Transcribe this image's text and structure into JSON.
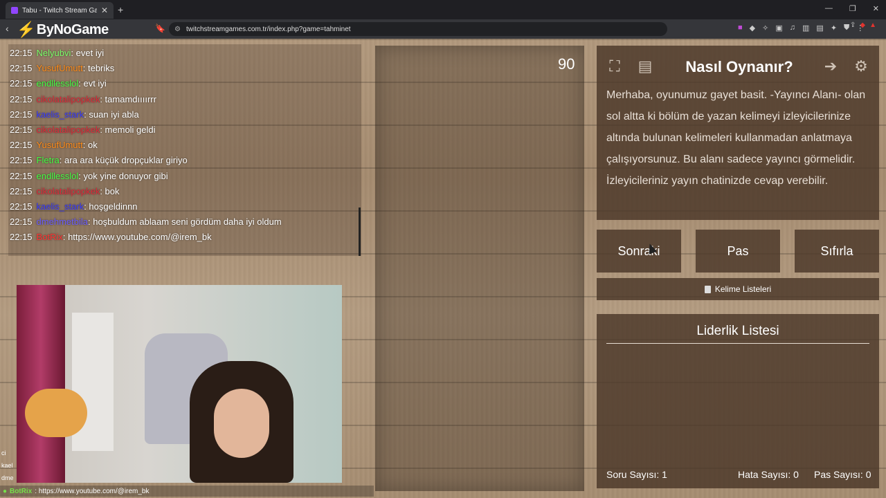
{
  "browser": {
    "tab_title": "Tabu - Twitch Stream Games",
    "new_tab": "+",
    "url": "twitchstreamgames.com.tr/index.php?game=tahminet",
    "brand": "ByNoGame"
  },
  "chat": {
    "messages": [
      {
        "time": "22:15",
        "user": "Nelyubvi",
        "text": ": evet iyi",
        "color": "#7dff6b"
      },
      {
        "time": "22:15",
        "user": "YusufUmutt",
        "text": ": tebriks",
        "color": "#ff8c1a"
      },
      {
        "time": "22:15",
        "user": "endllesslol",
        "text": ": evt iyi",
        "color": "#44ff44"
      },
      {
        "time": "22:15",
        "user": "cikolatalipopkek",
        "text": ": tamamdıııırrr",
        "color": "#e0293a"
      },
      {
        "time": "22:15",
        "user": "kaelis_stark",
        "text": ": suan iyi abla",
        "color": "#3a3cff"
      },
      {
        "time": "22:15",
        "user": "cikolatalipopkek",
        "text": ": memoli geldi",
        "color": "#e0293a"
      },
      {
        "time": "22:15",
        "user": "YusufUmutt",
        "text": ": ok",
        "color": "#ff8c1a"
      },
      {
        "time": "22:15",
        "user": "Fletra",
        "text": ": ara ara küçük dropçuklar giriyo",
        "color": "#44ff44"
      },
      {
        "time": "22:15",
        "user": "endllesslol",
        "text": ": yok yine donuyor gibi",
        "color": "#44ff44"
      },
      {
        "time": "22:15",
        "user": "cikolatalipopkek",
        "text": ": bok",
        "color": "#e0293a"
      },
      {
        "time": "22:15",
        "user": "kaelis_stark",
        "text": ": hoşgeldinnn",
        "color": "#3a3cff"
      },
      {
        "time": "22:15",
        "user": "dmehmetbila",
        "text": ": hoşbuldum ablaam seni gördüm daha iyi oldum",
        "color": "#6a5cff"
      },
      {
        "time": "22:15",
        "user": "BotRix",
        "text": ": https://www.youtube.com/@irem_bk",
        "color": "#ff3333"
      }
    ]
  },
  "bottom_chat": {
    "user": "BotRix",
    "text": ": https://www.youtube.com/@irem_bk"
  },
  "left_edge": {
    "a": "ci",
    "b": "kael",
    "c": "dme"
  },
  "game": {
    "timer": "90",
    "howto_title": "Nasıl Oynanır?",
    "howto_text": "Merhaba, oyunumuz gayet basit. -Yayıncı Alanı- olan sol altta ki bölüm de yazan kelimeyi izleyicilerinize altında bulunan kelimeleri kullanmadan anlatmaya çalışıyorsunuz. Bu alanı sadece yayıncı görmelidir. İzleyicileriniz yayın chatinizde cevap verebilir.",
    "buttons": {
      "next": "Sonraki",
      "pass": "Pas",
      "reset": "Sıfırla"
    },
    "word_lists": "Kelime Listeleri",
    "leaderboard_title": "Liderlik Listesi",
    "stats": {
      "questions": "Soru Sayısı: 1",
      "errors": "Hata Sayısı: 0",
      "passes": "Pas Sayısı: 0"
    }
  }
}
